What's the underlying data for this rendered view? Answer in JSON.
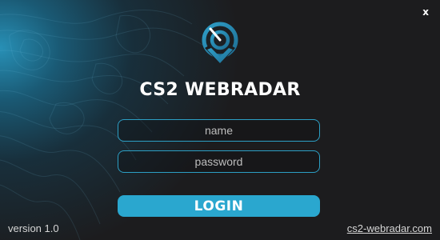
{
  "window": {
    "close_label": "x"
  },
  "app": {
    "title": "CS2 WEBRADAR",
    "logo_icon": "radar-pin-icon"
  },
  "form": {
    "name_placeholder": "name",
    "name_value": "",
    "password_placeholder": "password",
    "password_value": "",
    "login_label": "LOGIN"
  },
  "footer": {
    "version": "version 1.0",
    "link": "cs2-webradar.com"
  },
  "colors": {
    "accent": "#2aa7cf",
    "background": "#1c1c1e",
    "glow": "#2896be"
  }
}
